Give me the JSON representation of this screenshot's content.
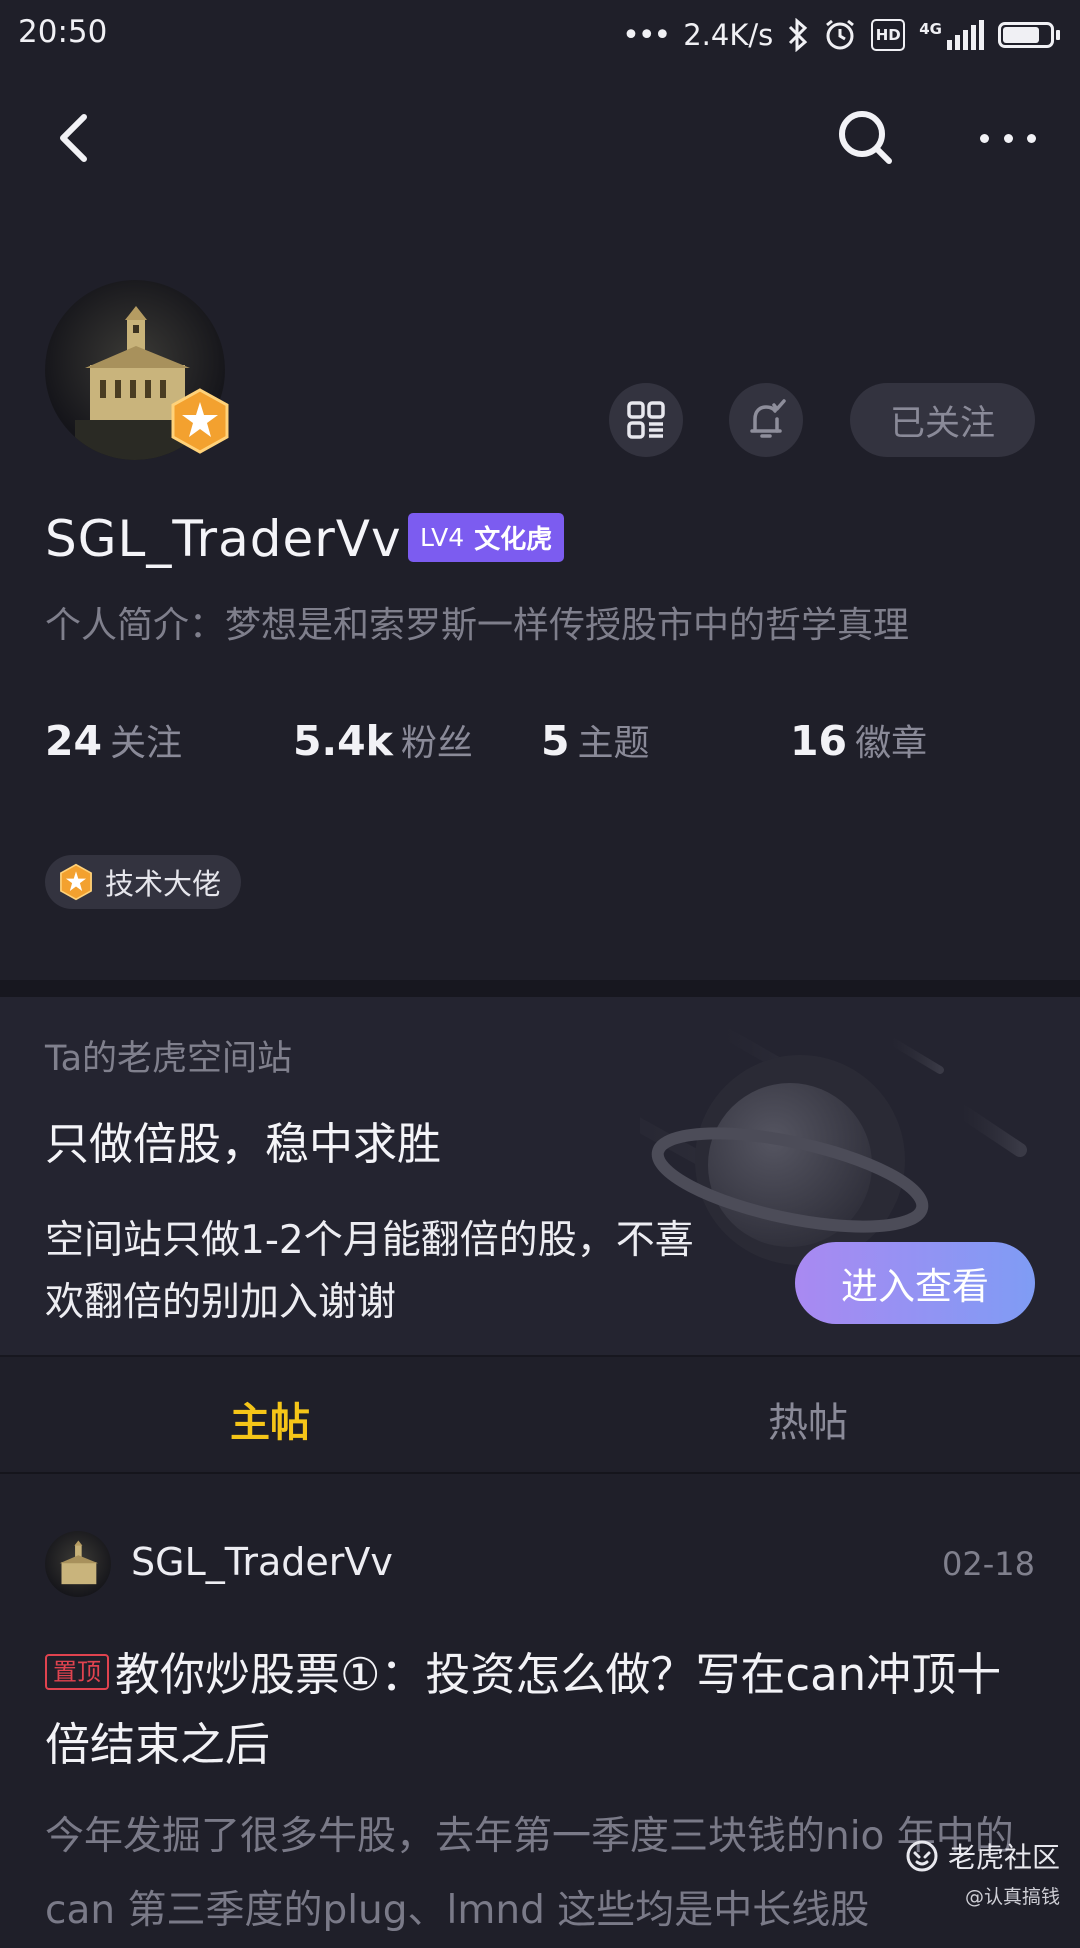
{
  "status_bar": {
    "time": "20:50",
    "network_speed": "2.4K/s",
    "network_type": "4G",
    "hd_label": "HD"
  },
  "header": {
    "back_icon": "chevron-left-icon",
    "search_icon": "search-icon",
    "more_icon": "more-dots-icon"
  },
  "profile": {
    "username": "SGL_TraderVv",
    "level": "LV4",
    "level_title": "文化虎",
    "bio": "个人简介：梦想是和索罗斯一样传授股市中的哲学真理",
    "follow_button": "已关注",
    "stats": [
      {
        "value": "24",
        "label": "关注"
      },
      {
        "value": "5.4k",
        "label": "粉丝"
      },
      {
        "value": "5",
        "label": "主题"
      },
      {
        "value": "16",
        "label": "徽章"
      }
    ],
    "skill_tag": "技术大佬"
  },
  "station": {
    "label": "Ta的老虎空间站",
    "title": "只做倍股，稳中求胜",
    "description": "空间站只做1-2个月能翻倍的股，不喜欢翻倍的别加入谢谢",
    "enter_button": "进入查看"
  },
  "tabs": [
    {
      "label": "主帖",
      "active": true
    },
    {
      "label": "热帖",
      "active": false
    }
  ],
  "post": {
    "author": "SGL_TraderVv",
    "date": "02-18",
    "pin_label": "置顶",
    "title": "教你炒股票①：投资怎么做？写在can冲顶十倍结束之后",
    "excerpt": "今年发掘了很多牛股，去年第一季度三块钱的nio 年中的can 第三季度的plug、lmnd 这些均是中长线股"
  },
  "watermark": {
    "brand": "老虎社区",
    "sub": "@认真搞钱"
  },
  "colors": {
    "background": "#1f1f29",
    "accent_yellow": "#f5c518",
    "level_purple": "#7c5cf0",
    "pin_red": "#e0434f"
  }
}
